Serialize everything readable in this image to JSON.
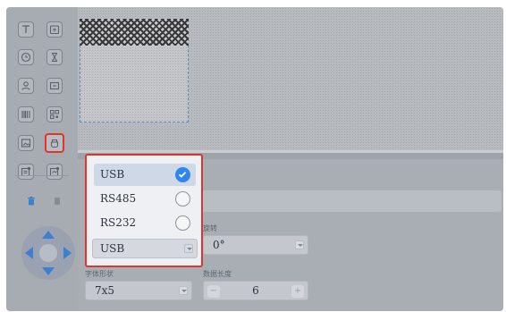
{
  "toolbar": {
    "tools": [
      "text-tool",
      "datetime-tool",
      "clock-tool",
      "countdown-tool",
      "serial-tool",
      "counter-tool",
      "barcode-tool",
      "qrcode-tool",
      "image-tool",
      "usb-tool",
      "import-tool",
      "export-tool"
    ]
  },
  "interface_dropdown": {
    "options": [
      {
        "label": "USB",
        "selected": true
      },
      {
        "label": "RS485",
        "selected": false
      },
      {
        "label": "RS232",
        "selected": false
      }
    ],
    "current_value": "USB"
  },
  "properties": {
    "rotation_label": "旋转",
    "rotation_value": "0°",
    "font_label": "字体形状",
    "font_value": "7x5",
    "length_label": "数据长度",
    "length_value": "6",
    "minus": "−",
    "plus": "+"
  },
  "colors": {
    "accent": "#2f86ee",
    "highlight_border": "#e0342c"
  }
}
